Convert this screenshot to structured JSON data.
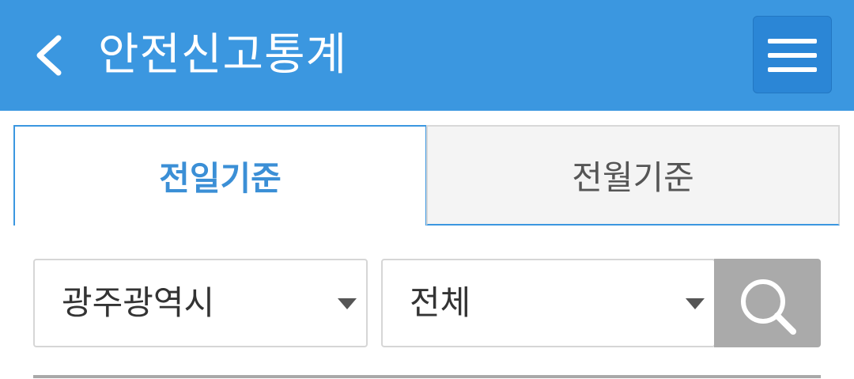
{
  "header": {
    "title": "안전신고통계",
    "back_icon": "chevron-left-icon",
    "menu_icon": "hamburger-menu-icon",
    "background_color": "#3b97e0"
  },
  "tabs": [
    {
      "label": "전일기준",
      "active": true
    },
    {
      "label": "전월기준",
      "active": false
    }
  ],
  "filters": {
    "region": {
      "selected": "광주광역시"
    },
    "category": {
      "selected": "전체"
    },
    "search_icon": "search-icon"
  },
  "colors": {
    "accent": "#3b97e0",
    "search_button": "#aaaaaa"
  }
}
